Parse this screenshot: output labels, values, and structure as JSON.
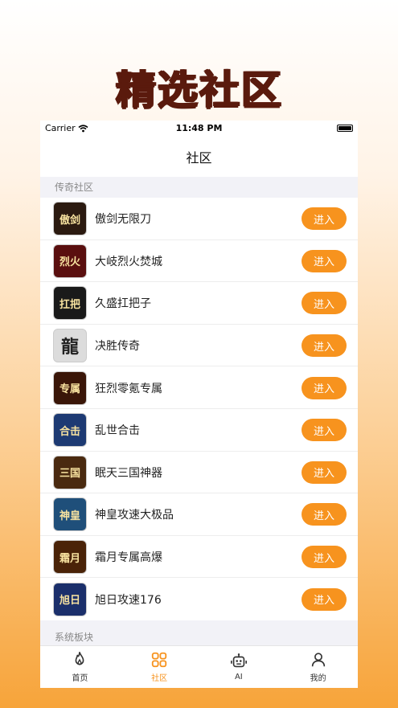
{
  "banner": {
    "title": "精选社区"
  },
  "status_bar": {
    "carrier": "Carrier",
    "time": "11:48 PM"
  },
  "nav": {
    "title": "社区"
  },
  "section1": {
    "header": "传奇社区"
  },
  "communities": [
    {
      "name": "傲剑无限刀",
      "thumb_text": "傲剑",
      "button": "进入",
      "thumb_color": "#2b1a10"
    },
    {
      "name": "大岐烈火焚城",
      "thumb_text": "烈火",
      "button": "进入",
      "thumb_color": "#5a0f0f"
    },
    {
      "name": "久盛扛把子",
      "thumb_text": "扛把",
      "button": "进入",
      "thumb_color": "#1a1a1a"
    },
    {
      "name": "决胜传奇",
      "thumb_text": "龍",
      "button": "进入",
      "thumb_color": "#dcdcdc"
    },
    {
      "name": "狂烈零氪专属",
      "thumb_text": "专属",
      "button": "进入",
      "thumb_color": "#3a1608"
    },
    {
      "name": "乱世合击",
      "thumb_text": "合击",
      "button": "进入",
      "thumb_color": "#1d3a73"
    },
    {
      "name": "眠天三国神器",
      "thumb_text": "三国",
      "button": "进入",
      "thumb_color": "#4a2a10"
    },
    {
      "name": "神皇攻速大极品",
      "thumb_text": "神皇",
      "button": "进入",
      "thumb_color": "#1f4f7a"
    },
    {
      "name": "霜月专属高爆",
      "thumb_text": "霜月",
      "button": "进入",
      "thumb_color": "#4a2308"
    },
    {
      "name": "旭日攻速176",
      "thumb_text": "旭日",
      "button": "进入",
      "thumb_color": "#1b2f6b"
    }
  ],
  "section2": {
    "header": "系统板块"
  },
  "tabs": [
    {
      "label": "首页",
      "icon": "flame-icon"
    },
    {
      "label": "社区",
      "icon": "grid-icon"
    },
    {
      "label": "AI",
      "icon": "robot-icon"
    },
    {
      "label": "我的",
      "icon": "person-icon"
    }
  ],
  "colors": {
    "accent": "#f7931e",
    "banner_text": "#5a1a0d"
  }
}
